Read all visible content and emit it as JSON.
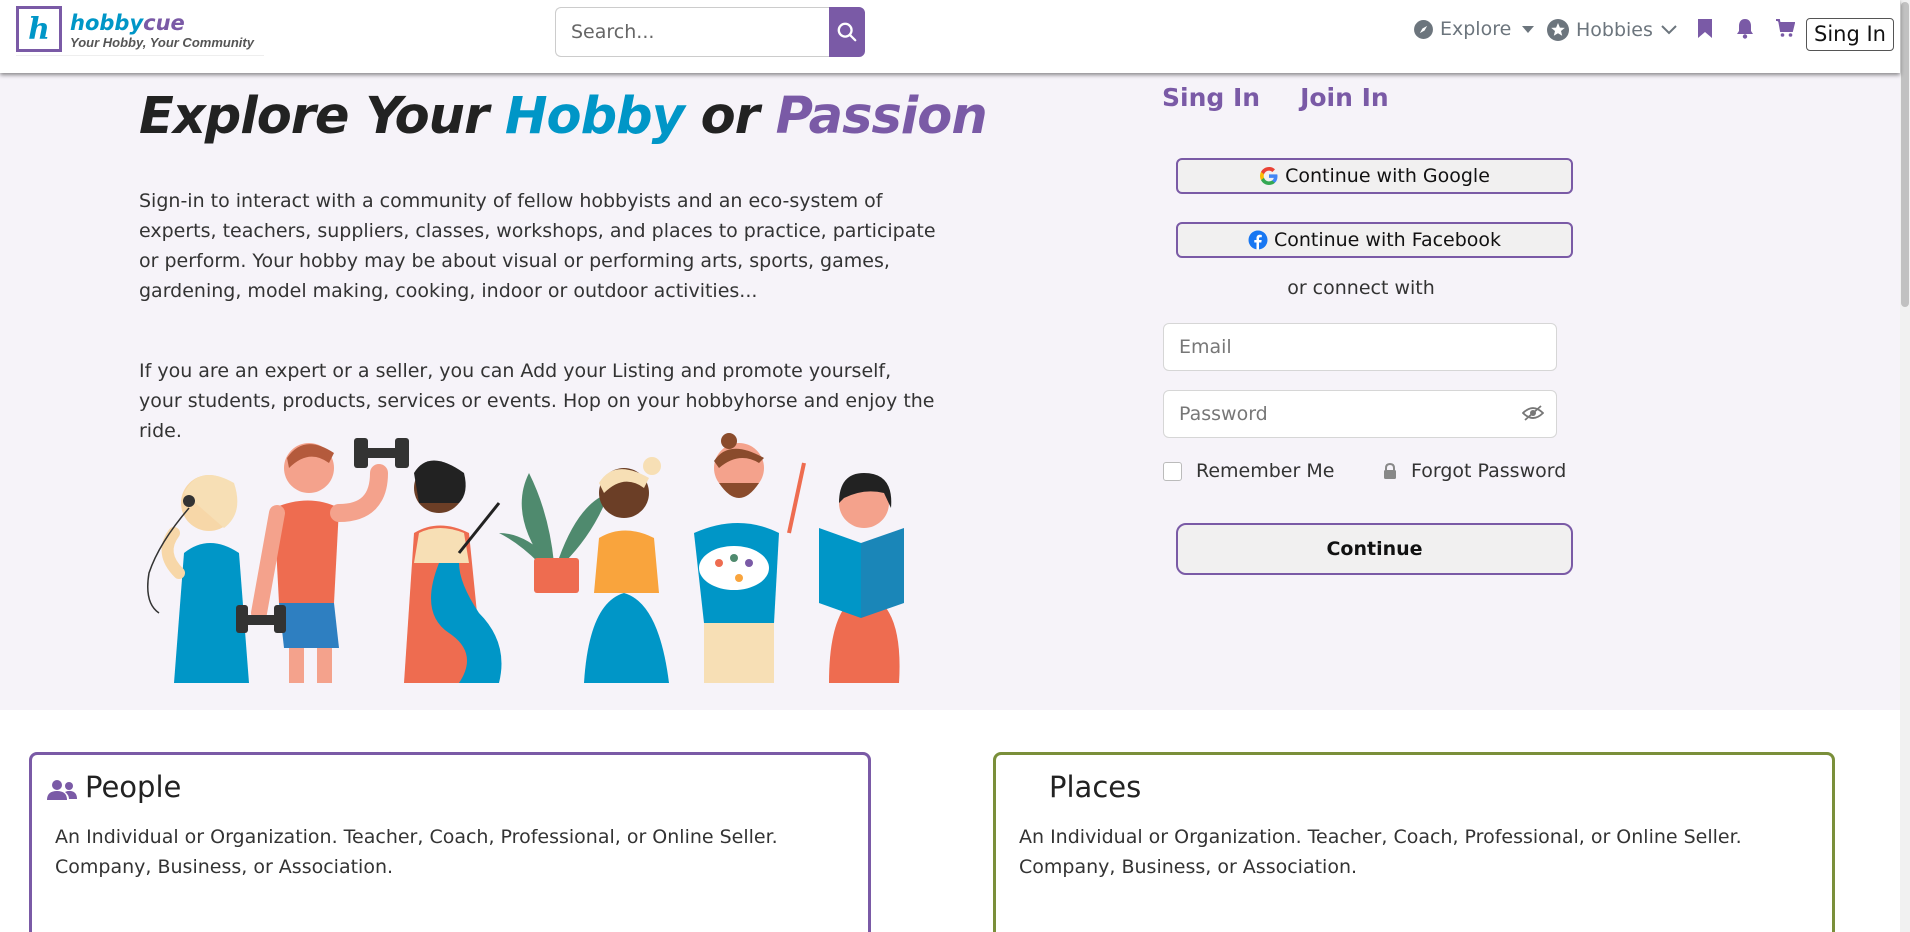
{
  "header": {
    "logo_letter": "h",
    "logo_name_a": "hobby",
    "logo_name_b": "cue",
    "logo_tagline": "Your Hobby, Your Community",
    "search_placeholder": "Search...",
    "explore_label": "Explore",
    "hobbies_label": "Hobbies",
    "signin_label": "Sing In"
  },
  "hero": {
    "title_a": "Explore Your ",
    "title_b": "Hobby",
    "title_c": " or ",
    "title_d": "Passion",
    "para1": "Sign-in to interact with a community of fellow hobbyists and an eco-system of experts, teachers, suppliers, classes, workshops, and places to practice, participate or perform. Your hobby may be about visual or performing arts, sports, games, gardening, model making, cooking, indoor or outdoor activities...",
    "para2": "If you are an expert or a seller, you can Add your Listing and promote yourself, your students, products, services or events. Hop on your hobbyhorse and enjoy the ride."
  },
  "auth": {
    "tab_signin": "Sing In",
    "tab_join": "Join In",
    "google_label": "Continue with Google",
    "facebook_label": "Continue with Facebook",
    "or_connect": "or connect with",
    "email_placeholder": "Email",
    "password_placeholder": "Password",
    "remember_label": "Remember Me",
    "forgot_label": "Forgot Password",
    "continue_label": "Continue"
  },
  "cards": [
    {
      "title": "People",
      "text": "An Individual or Organization. Teacher, Coach, Professional, or Online Seller. Company, Business, or Association."
    },
    {
      "title": "Places",
      "text": "An Individual or Organization. Teacher, Coach, Professional, or Online Seller. Company, Business, or Association."
    }
  ],
  "colors": {
    "brand_purple": "#7a5aa6",
    "brand_blue": "#0096c7",
    "places_border": "#7a8f3a",
    "hero_bg": "#f6f3f9"
  }
}
